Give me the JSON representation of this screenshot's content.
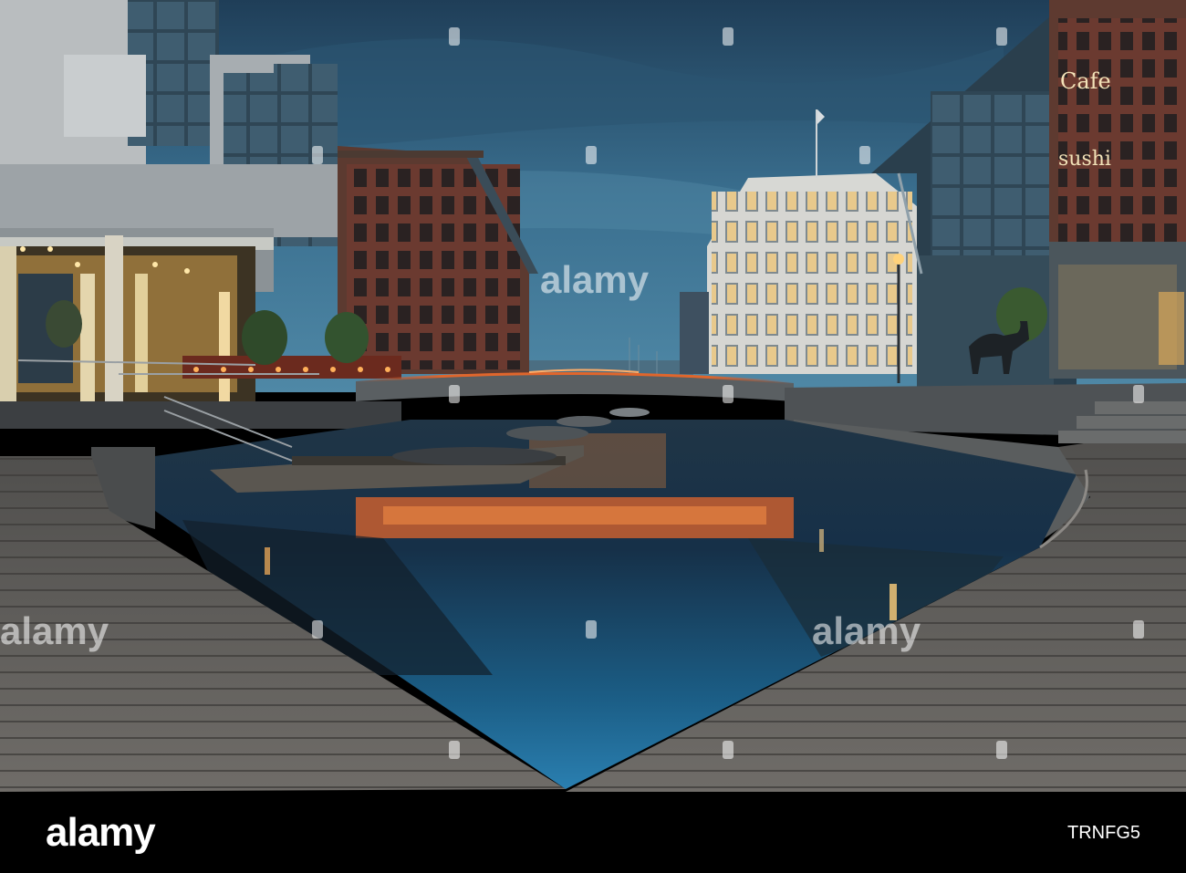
{
  "watermark": {
    "text": "alamy"
  },
  "footer": {
    "brand": "alamy",
    "image_id": "TRNFG5"
  },
  "signs": {
    "cafe": "Cafe",
    "sushi": "sushi"
  },
  "colors": {
    "sky": "#3a6f8f",
    "sky_dark": "#1f3e58",
    "water": "#1b5d85",
    "water_reflection_orange": "#e0662c",
    "boardwalk": "#6a6763",
    "building_light": "#f6c66a",
    "footer": "#000000"
  }
}
